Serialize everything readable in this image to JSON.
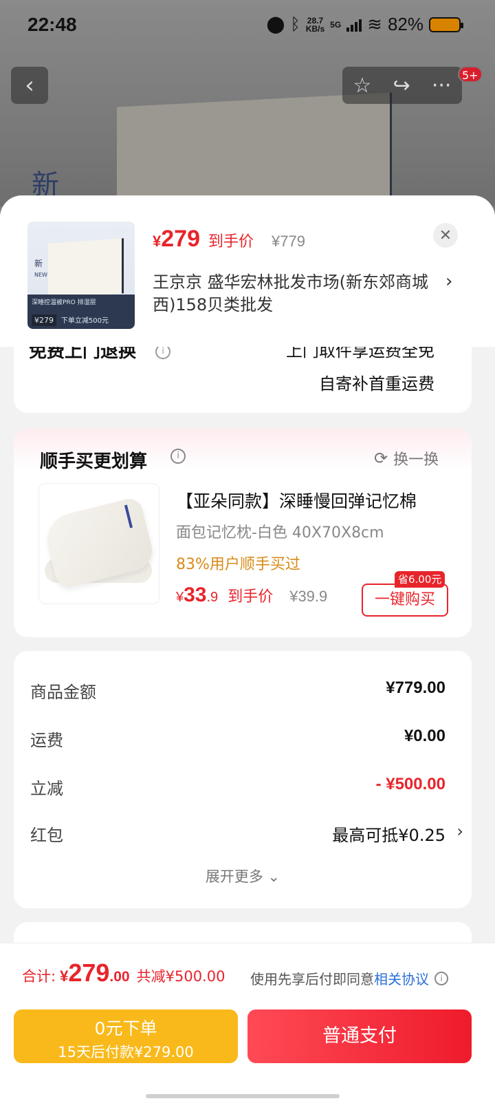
{
  "status_bar": {
    "time": "22:48",
    "speed_value": "28.7",
    "speed_unit": "KB/s",
    "network": "5G",
    "battery": "82%"
  },
  "header": {
    "badge": "5+",
    "bg_text": "新"
  },
  "product": {
    "price_symbol": "¥",
    "price": "279",
    "price_tag": "到手价",
    "original_price": "¥779",
    "address": "王京京  盛华宏林批发市场(新东郊商城西)158贝类批发",
    "thumb_new": "新",
    "thumb_new_en": "NEW",
    "thumb_title": "深睡控温被PRO 排湿层",
    "thumb_price": "¥279",
    "thumb_promo": "下单立减500元"
  },
  "return_service": {
    "label": "免费上门退换",
    "line1": "上门取件享运费全免",
    "line2": "自寄补首重运费"
  },
  "recommend": {
    "title": "顺手买更划算",
    "swap": "换一换",
    "name": "【亚朵同款】深睡慢回弹记忆棉",
    "spec": "面包记忆枕-白色   40X70X8cm",
    "social": "83%用户顺手买过",
    "price_symbol": "¥",
    "price_int": "33",
    "price_dec": ".9",
    "price_tag": "到手价",
    "original_price": "¥39.9",
    "save_badge": "省6.00元",
    "buy_label": "一键购买"
  },
  "details": {
    "rows": [
      {
        "label": "商品金额",
        "value": "¥779.00"
      },
      {
        "label": "运费",
        "value": "¥0.00"
      },
      {
        "label": "立减",
        "value": "- ¥500.00"
      },
      {
        "label": "红包",
        "value": "最高可抵¥0.25"
      }
    ],
    "expand": "展开更多"
  },
  "footer": {
    "total_label": "合计:",
    "currency": "¥",
    "total_int": "279",
    "total_dec": ".00",
    "saved": "共减¥500.00",
    "agree_text": "使用先享后付即同意",
    "agree_link": "相关协议",
    "later_title": "0元下单",
    "later_sub": "15天后付款¥279.00",
    "pay_label": "普通支付"
  },
  "colors": {
    "accent_red": "#e8242b",
    "later_yellow": "#f9b91a",
    "link_blue": "#2a6fd8"
  }
}
